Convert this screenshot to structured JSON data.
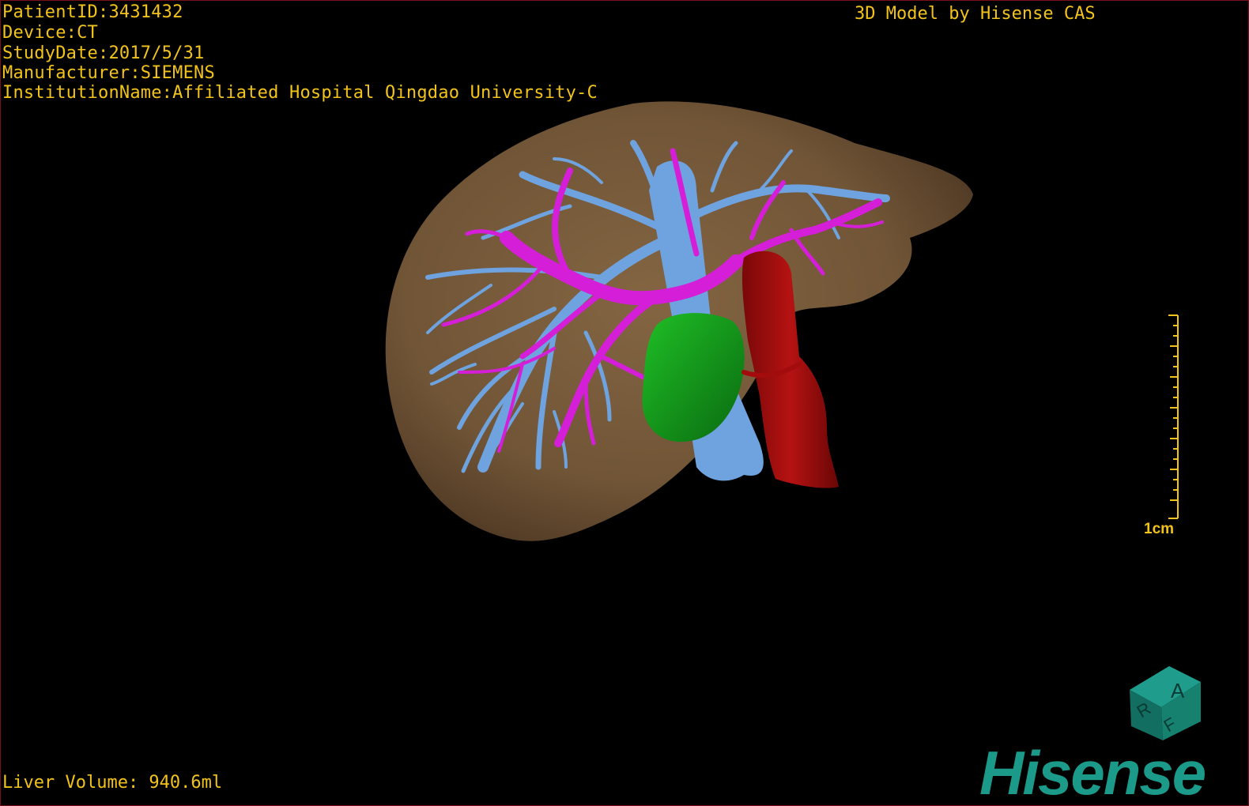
{
  "header": {
    "patient_id": "PatientID:3431432",
    "device": "Device:CT",
    "study_date": "StudyDate:2017/5/31",
    "manufacturer": "Manufacturer:SIEMENS",
    "institution": "InstitutionName:Affiliated Hospital Qingdao University-C"
  },
  "credit": "3D Model by Hisense CAS",
  "volume": "Liver Volume: 940.6ml",
  "scale": {
    "label": "1cm"
  },
  "orientation_cube": {
    "top": "A",
    "left": "R",
    "bottom": "F"
  },
  "brand": "Hisense",
  "colors": {
    "text": "#f2c31b",
    "liver": "#8a6a45",
    "hepatic_vein": "#6fa3df",
    "portal_vein": "#d51ed8",
    "artery": "#a30c0c",
    "lesion": "#13a51b",
    "brand": "#1b9a8a",
    "border": "#7a0f1a"
  }
}
